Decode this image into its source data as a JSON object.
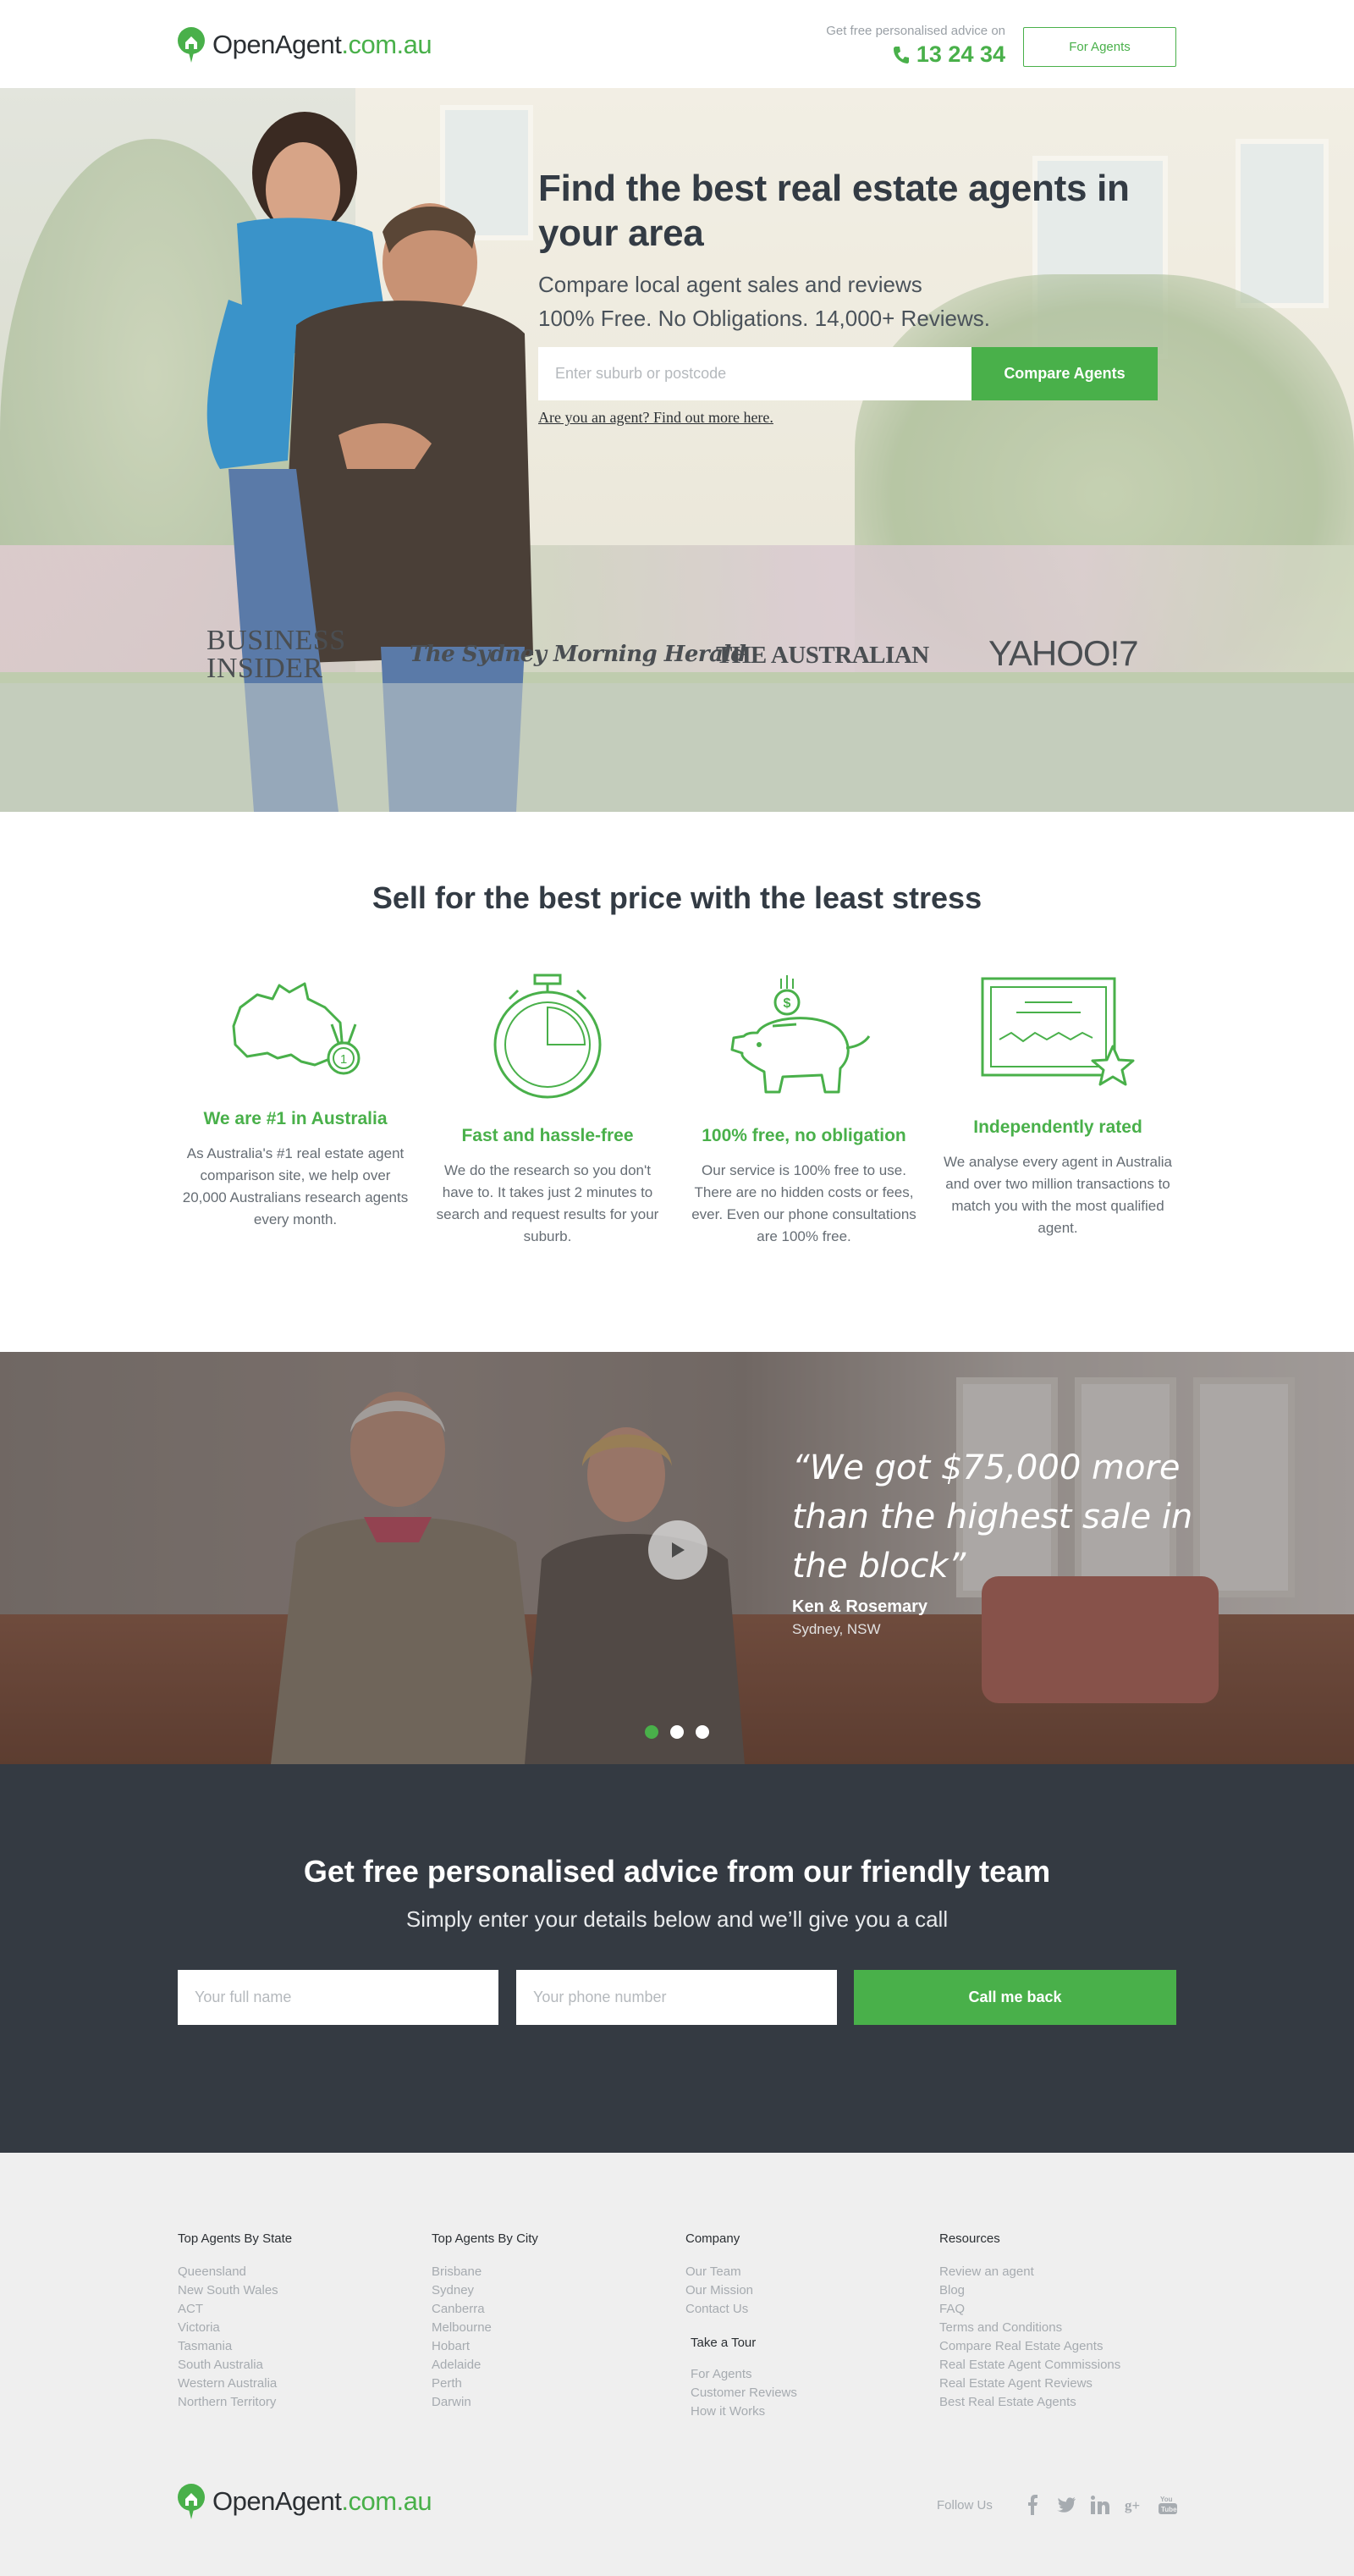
{
  "brand": {
    "name_part1": "OpenAgent",
    "name_part2": ".com.au",
    "accent": "#49b04a",
    "dark": "#343a42"
  },
  "header": {
    "advice_label": "Get free personalised advice on",
    "phone": "13 24 34",
    "phone_icon": "phone-icon",
    "for_agents": "For Agents"
  },
  "hero": {
    "title": "Find the best real estate agents in your area",
    "sub1": "Compare local agent sales and reviews",
    "sub2": "100% Free. No Obligations. 14,000+ Reviews.",
    "search_placeholder": "Enter suburb or postcode",
    "cta": "Compare Agents",
    "agent_link": "Are you an agent? Find out more here.",
    "press": [
      "BUSINESS",
      "INSIDER",
      "The Sydney Morning Herald",
      "THE AUSTRALIAN",
      "YAHOO!7"
    ]
  },
  "features": {
    "title": "Sell for the best price with the least stress",
    "items": [
      {
        "icon": "australia-medal-icon",
        "medal_label": "1",
        "title": "We are #1 in Australia",
        "desc": "As Australia's #1 real estate agent comparison site, we help over 20,000 Australians research agents every month."
      },
      {
        "icon": "stopwatch-icon",
        "title": "Fast and hassle-free",
        "desc": "We do the research so you don't have to. It takes just 2 minutes to search and request results for your suburb."
      },
      {
        "icon": "piggy-bank-icon",
        "coin_label": "$",
        "title": "100% free, no obligation",
        "desc": "Our service is 100% free to use. There are no hidden costs or fees, ever. Even our phone consultations are 100% free."
      },
      {
        "icon": "certificate-star-icon",
        "title": "Independently rated",
        "desc": "We analyse every agent in Australia and over two million transactions to match you with the most qualified agent."
      }
    ]
  },
  "testimonial": {
    "quote": "“We got $75,000 more than the highest sale in the block”",
    "name": "Ken & Rosemary",
    "location": "Sydney, NSW",
    "play_icon": "play-icon",
    "slides": 3,
    "active_slide": 1
  },
  "callback": {
    "title": "Get free personalised advice from our friendly team",
    "sub": "Simply enter your details below and we’ll give you a call",
    "name_placeholder": "Your full name",
    "phone_placeholder": "Your phone number",
    "button": "Call me back"
  },
  "footer": {
    "columns": [
      {
        "title": "Top Agents By State",
        "links": [
          "Queensland",
          "New South Wales",
          "ACT",
          "Victoria",
          "Tasmania",
          "South Australia",
          "Western Australia",
          "Northern Territory"
        ]
      },
      {
        "title": "Top Agents By City",
        "links": [
          "Brisbane",
          "Sydney",
          "Canberra",
          "Melbourne",
          "Hobart",
          "Adelaide",
          "Perth",
          "Darwin"
        ]
      },
      {
        "title": "Company",
        "links": [
          "Our Team",
          "Our Mission",
          "Contact Us"
        ]
      },
      {
        "title": "Resources",
        "links": [
          "Review an agent",
          "Blog",
          "FAQ",
          "Terms and Conditions",
          "Compare Real Estate Agents",
          "Real Estate Agent Commissions",
          "Real Estate Agent Reviews",
          "Best Real Estate Agents"
        ]
      }
    ],
    "tour": {
      "title": "Take a Tour",
      "links": [
        "For Agents",
        "Customer Reviews",
        "How it Works"
      ]
    },
    "follow_label": "Follow Us",
    "social": [
      "facebook-icon",
      "twitter-icon",
      "linkedin-icon",
      "google-plus-icon",
      "youtube-icon"
    ]
  }
}
